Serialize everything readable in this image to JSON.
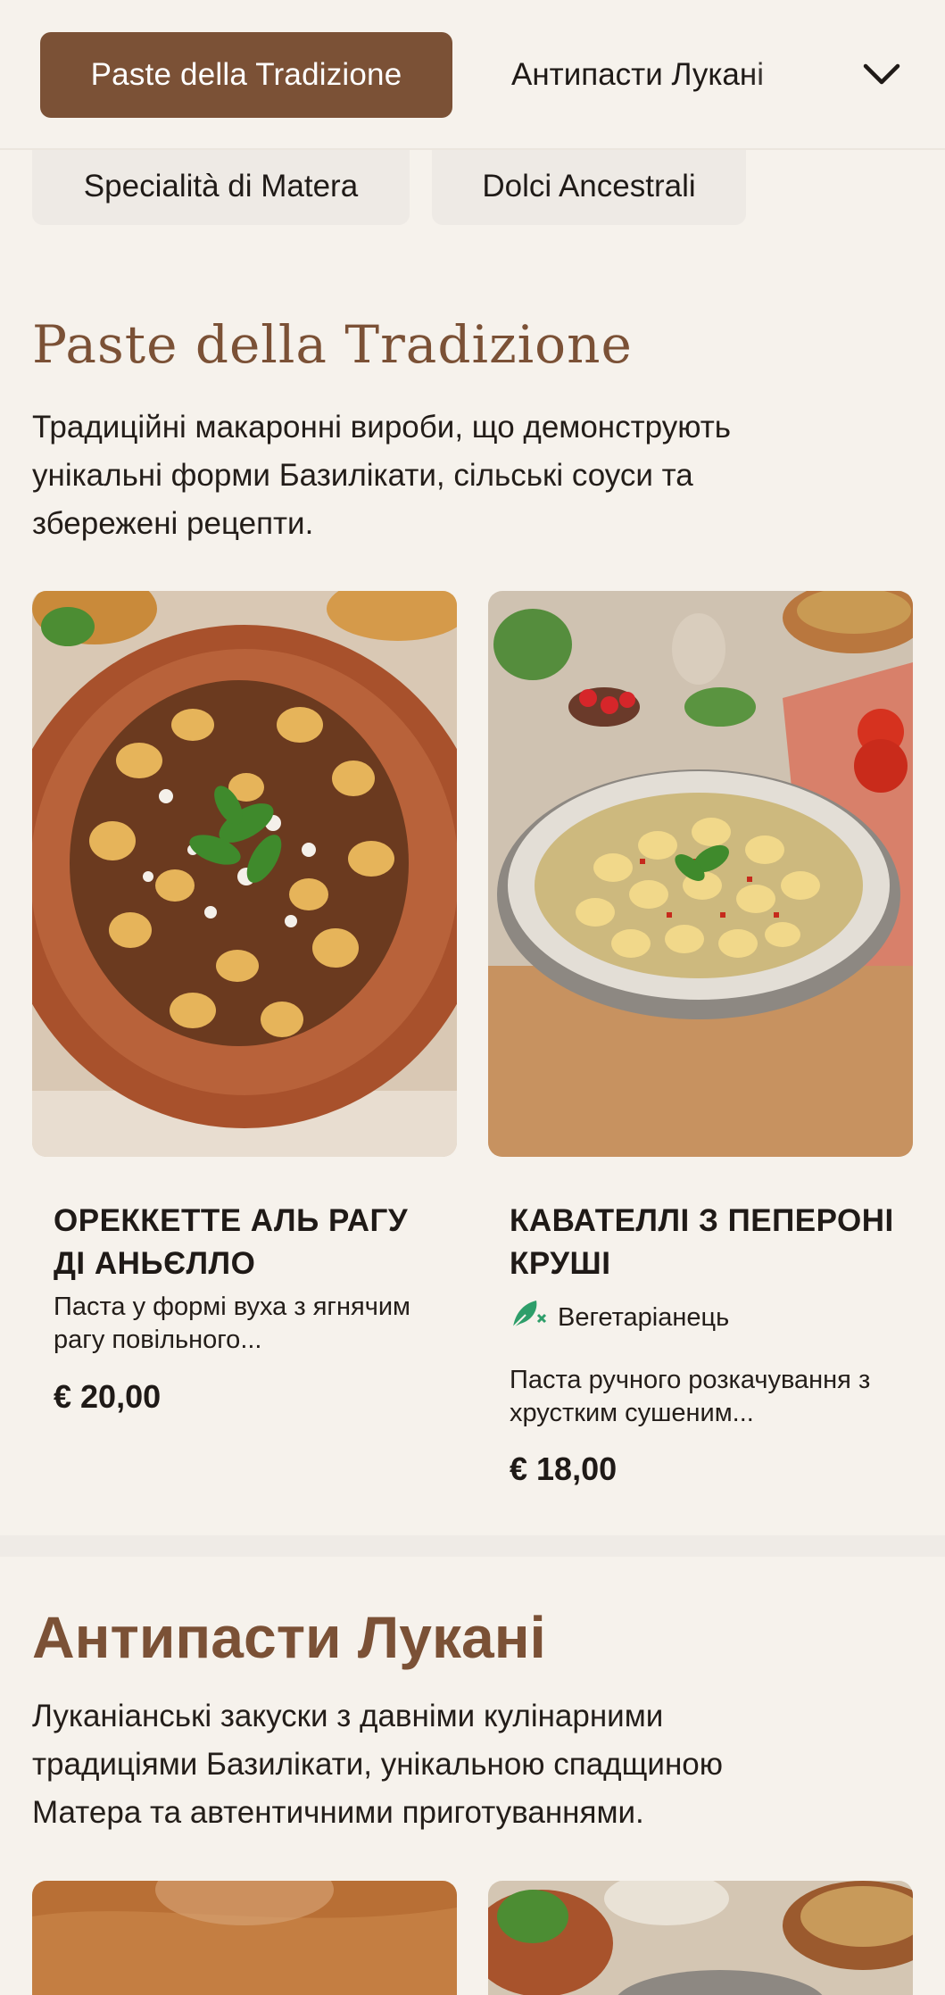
{
  "nav": {
    "active_tab": "Paste della Tradizione",
    "next_tab": "Антипасти Лукані",
    "row2": [
      "Specialità di Matera",
      "Dolci Ancestrali"
    ]
  },
  "section1": {
    "title": "Paste della Tradizione",
    "description": "Традиційні макаронні вироби, що демонструють унікальні форми Базилікати, сільські соуси та збережені рецепти.",
    "items": [
      {
        "title": "ОРЕККЕТТЕ АЛЬ РАГУ ДІ АНЬЄЛЛО",
        "description": "Паста у формі вуха з ягнячим рагу повільного...",
        "price": "€ 20,00"
      },
      {
        "title": "КАВАТЕЛЛІ З ПЕПЕРОНІ КРУШІ",
        "tag": "Вегетаріанець",
        "description": "Паста ручного розкачування з хрустким сушеним...",
        "price": "€ 18,00"
      }
    ]
  },
  "section2": {
    "title": "Антипасти Лукані",
    "description": "Луканіанські закуски з давніми кулінарними традиціями Базилікати, унікальною спадщиною Матера та автентичними приготуваннями."
  },
  "colors": {
    "accent": "#7b5136",
    "background": "#f6f2ec",
    "veg_icon": "#2e9e6a"
  },
  "icons": {
    "chevron": "chevron-down-icon",
    "veg": "leaf-icon"
  }
}
